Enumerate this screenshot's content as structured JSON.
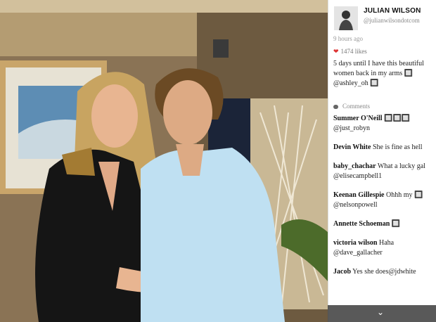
{
  "profile": {
    "username": "JULIAN WILSON",
    "handle": "@julianwilsondotcom"
  },
  "post": {
    "time_ago": "9 hours ago",
    "likes": "1474 likes",
    "caption": "5 days until I have this beautiful women back in my arms 🔲 @ashley_oh 🔲"
  },
  "comments_label": "Comments",
  "comments": [
    {
      "user": "Summer O'Neill",
      "text": "🔲🔲🔲 @just_robyn"
    },
    {
      "user": "Devin White",
      "text": "She is fine as hell"
    },
    {
      "user": "baby_chachar",
      "text": "What a lucky gal @elisecampbell1"
    },
    {
      "user": "Keenan Gillespie",
      "text": "Ohhh my 🔲 @nelsonpowell"
    },
    {
      "user": "Annette Schoeman",
      "text": "🔲"
    },
    {
      "user": "victoria wilson",
      "text": "Haha @dave_gallacher"
    },
    {
      "user": "Jacob",
      "text": "Yes she does@jdwhite"
    }
  ],
  "icons": {
    "heart": "heart-icon",
    "comments": "comment-bubble-icon",
    "scroll": "chevron-down-icon"
  },
  "colors": {
    "heart": "#dd3333",
    "scrollbar": "#3c3c3c"
  }
}
